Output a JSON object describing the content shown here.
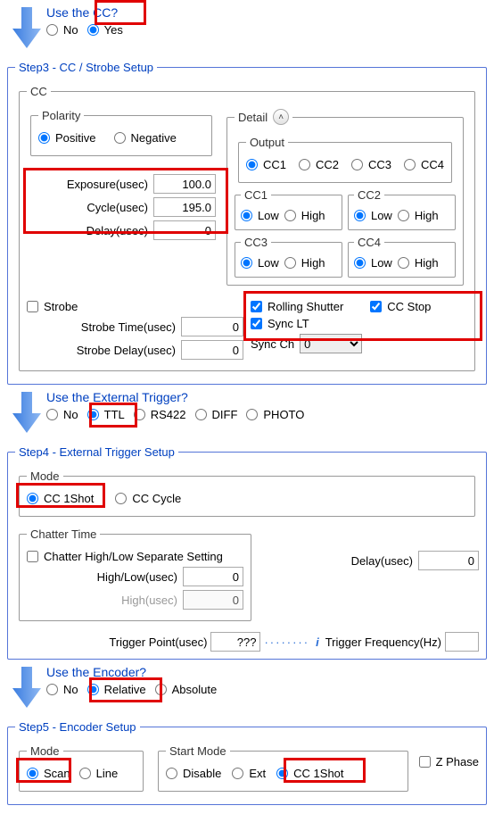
{
  "q_cc": {
    "title": "Use the CC?",
    "no": "No",
    "yes": "Yes"
  },
  "step3": {
    "legend": "Step3 - CC / Strobe Setup",
    "cc_legend": "CC",
    "polarity": {
      "legend": "Polarity",
      "positive": "Positive",
      "negative": "Negative"
    },
    "exposure_label": "Exposure(usec)",
    "exposure_value": "100.0",
    "cycle_label": "Cycle(usec)",
    "cycle_value": "195.0",
    "delay_label": "Delay(usec)",
    "delay_value": "0",
    "strobe_label": "Strobe",
    "strobe_time_label": "Strobe Time(usec)",
    "strobe_time_value": "0",
    "strobe_delay_label": "Strobe Delay(usec)",
    "strobe_delay_value": "0",
    "detail": {
      "label": "Detail",
      "output": "Output",
      "cc1": "CC1",
      "cc2": "CC2",
      "cc3": "CC3",
      "cc4": "CC4",
      "low": "Low",
      "high": "High",
      "rolling": "Rolling Shutter",
      "ccstop": "CC Stop",
      "synclt": "Sync LT",
      "syncch_label": "Sync Ch",
      "syncch_value": "0"
    }
  },
  "q_ext": {
    "title": "Use the External Trigger?",
    "no": "No",
    "ttl": "TTL",
    "rs422": "RS422",
    "diff": "DIFF",
    "photo": "PHOTO"
  },
  "step4": {
    "legend": "Step4 - External Trigger Setup",
    "mode_legend": "Mode",
    "cc1shot": "CC 1Shot",
    "cccycle": "CC Cycle",
    "chatter_legend": "Chatter Time",
    "separate": "Chatter High/Low Separate Setting",
    "highlow_label": "High/Low(usec)",
    "highlow_value": "0",
    "high_label": "High(usec)",
    "high_value": "0",
    "delay_label": "Delay(usec)",
    "delay_value": "0",
    "triggerpt_label": "Trigger Point(usec)",
    "triggerpt_value": "???",
    "freq_label": "Trigger Frequency(Hz)",
    "freq_value": ""
  },
  "q_enc": {
    "title": "Use the Encoder?",
    "no": "No",
    "relative": "Relative",
    "absolute": "Absolute"
  },
  "step5": {
    "legend": "Step5 - Encoder Setup",
    "mode_legend": "Mode",
    "scan": "Scan",
    "line": "Line",
    "start_legend": "Start Mode",
    "disable": "Disable",
    "ext": "Ext",
    "cc1shot": "CC 1Shot",
    "zphase": "Z Phase"
  }
}
